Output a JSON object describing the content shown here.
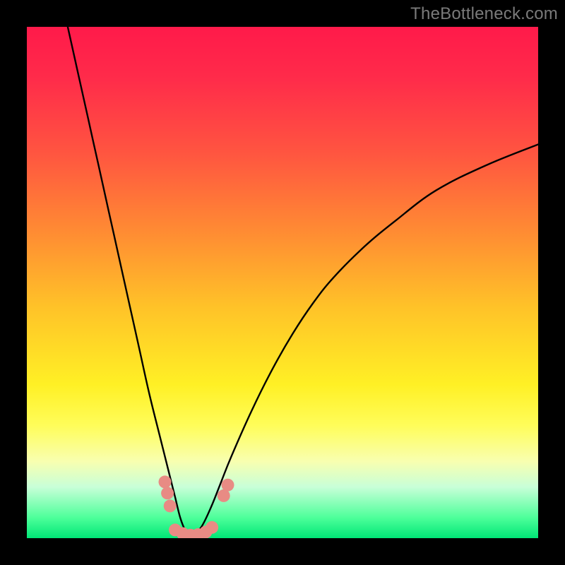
{
  "watermark": {
    "text": "TheBottleneck.com"
  },
  "chart_data": {
    "type": "line",
    "title": "",
    "xlabel": "",
    "ylabel": "",
    "xlim": [
      0,
      100
    ],
    "ylim": [
      0,
      100
    ],
    "notes": "V-shaped bottleneck curve. Minimum near x≈32. Background gradient: red (high) → green (low). Small salmon bead markers cluster near the trough.",
    "series": [
      {
        "name": "left-branch",
        "x": [
          8,
          10,
          12,
          14,
          16,
          18,
          20,
          22,
          24,
          26,
          28,
          29,
          30,
          31,
          32
        ],
        "y": [
          100,
          91,
          82,
          73,
          64,
          55,
          46,
          37,
          28,
          20,
          12,
          8,
          4,
          1.5,
          0.4
        ]
      },
      {
        "name": "right-branch",
        "x": [
          32,
          34,
          36,
          38,
          40,
          44,
          48,
          52,
          56,
          60,
          66,
          72,
          80,
          90,
          100
        ],
        "y": [
          0.4,
          2,
          6,
          11,
          16,
          25,
          33,
          40,
          46,
          51,
          57,
          62,
          68,
          73,
          77
        ]
      }
    ],
    "markers": {
      "name": "trough-beads",
      "color": "#e88b84",
      "points": [
        {
          "x": 27.0,
          "y": 11.0
        },
        {
          "x": 27.5,
          "y": 8.8
        },
        {
          "x": 28.0,
          "y": 6.3
        },
        {
          "x": 29.0,
          "y": 1.6
        },
        {
          "x": 30.5,
          "y": 0.9
        },
        {
          "x": 32.0,
          "y": 0.6
        },
        {
          "x": 33.5,
          "y": 0.7
        },
        {
          "x": 35.0,
          "y": 1.2
        },
        {
          "x": 36.2,
          "y": 2.1
        },
        {
          "x": 38.5,
          "y": 8.3
        },
        {
          "x": 39.3,
          "y": 10.4
        }
      ]
    }
  }
}
